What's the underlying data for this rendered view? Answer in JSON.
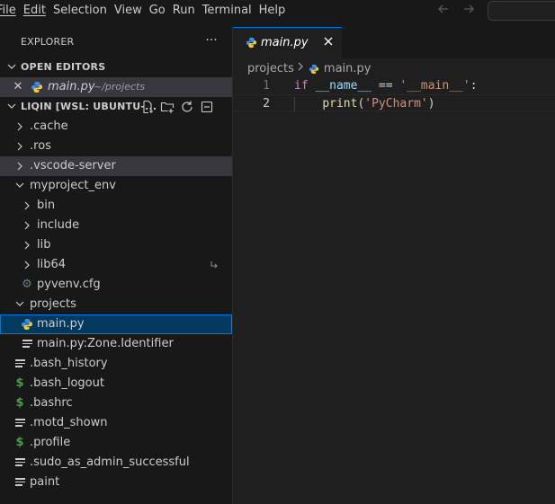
{
  "menubar": {
    "items": [
      "File",
      "Edit",
      "Selection",
      "View",
      "Go",
      "Run",
      "Terminal",
      "Help"
    ],
    "back_icon": "arrow-left-icon",
    "forward_icon": "arrow-right-icon"
  },
  "sidebar": {
    "title": "EXPLORER",
    "more_icon": "ellipsis-icon",
    "open_editors": {
      "label": "OPEN EDITORS",
      "items": [
        {
          "name": "main.py",
          "description": "~/projects"
        }
      ]
    },
    "workspace": {
      "label": "LIQIN [WSL: UBUNTU-...",
      "toolbar_icons": [
        "new-file-icon",
        "new-folder-icon",
        "refresh-icon",
        "collapse-all-icon"
      ]
    },
    "tree": [
      {
        "name": ".cache",
        "type": "folder",
        "expanded": false,
        "depth": 0
      },
      {
        "name": ".ros",
        "type": "folder",
        "expanded": false,
        "depth": 0
      },
      {
        "name": ".vscode-server",
        "type": "folder",
        "expanded": false,
        "depth": 0
      },
      {
        "name": "myproject_env",
        "type": "folder",
        "expanded": true,
        "depth": 0
      },
      {
        "name": "bin",
        "type": "folder",
        "expanded": false,
        "depth": 1
      },
      {
        "name": "include",
        "type": "folder",
        "expanded": false,
        "depth": 1
      },
      {
        "name": "lib",
        "type": "folder",
        "expanded": false,
        "depth": 1
      },
      {
        "name": "lib64",
        "type": "folder",
        "expanded": false,
        "depth": 1,
        "symlink": true
      },
      {
        "name": "pyvenv.cfg",
        "type": "gear",
        "depth": 1
      },
      {
        "name": "projects",
        "type": "folder",
        "expanded": true,
        "depth": 0
      },
      {
        "name": "main.py",
        "type": "python",
        "depth": 1
      },
      {
        "name": "main.py:Zone.Identifier",
        "type": "text",
        "depth": 1
      },
      {
        "name": ".bash_history",
        "type": "text",
        "depth": 0
      },
      {
        "name": ".bash_logout",
        "type": "shell",
        "depth": 0
      },
      {
        "name": ".bashrc",
        "type": "shell",
        "depth": 0
      },
      {
        "name": ".motd_shown",
        "type": "text",
        "depth": 0
      },
      {
        "name": ".profile",
        "type": "shell",
        "depth": 0
      },
      {
        "name": ".sudo_as_admin_successful",
        "type": "text",
        "depth": 0
      },
      {
        "name": "paint",
        "type": "text",
        "depth": 0
      }
    ]
  },
  "editor": {
    "tab": {
      "label": "main.py"
    },
    "breadcrumb": [
      "projects",
      "main.py"
    ],
    "lines": [
      {
        "number": "1",
        "tokens": [
          {
            "t": "if",
            "c": "kw"
          },
          {
            "t": " ",
            "c": "op"
          },
          {
            "t": "__name__",
            "c": "var"
          },
          {
            "t": " == ",
            "c": "op"
          },
          {
            "t": "'__main__'",
            "c": "str"
          },
          {
            "t": ":",
            "c": "punc"
          }
        ]
      },
      {
        "number": "2",
        "tokens": [
          {
            "t": "    ",
            "c": "op"
          },
          {
            "t": "print",
            "c": "fn"
          },
          {
            "t": "(",
            "c": "punc"
          },
          {
            "t": "'PyCharm'",
            "c": "str"
          },
          {
            "t": ")",
            "c": "punc"
          }
        ]
      }
    ]
  },
  "colors": {
    "accent": "#0078d4",
    "python_blue": "#3b8eea",
    "python_yellow": "#f0c940",
    "shell_green": "#4d9a4d"
  }
}
